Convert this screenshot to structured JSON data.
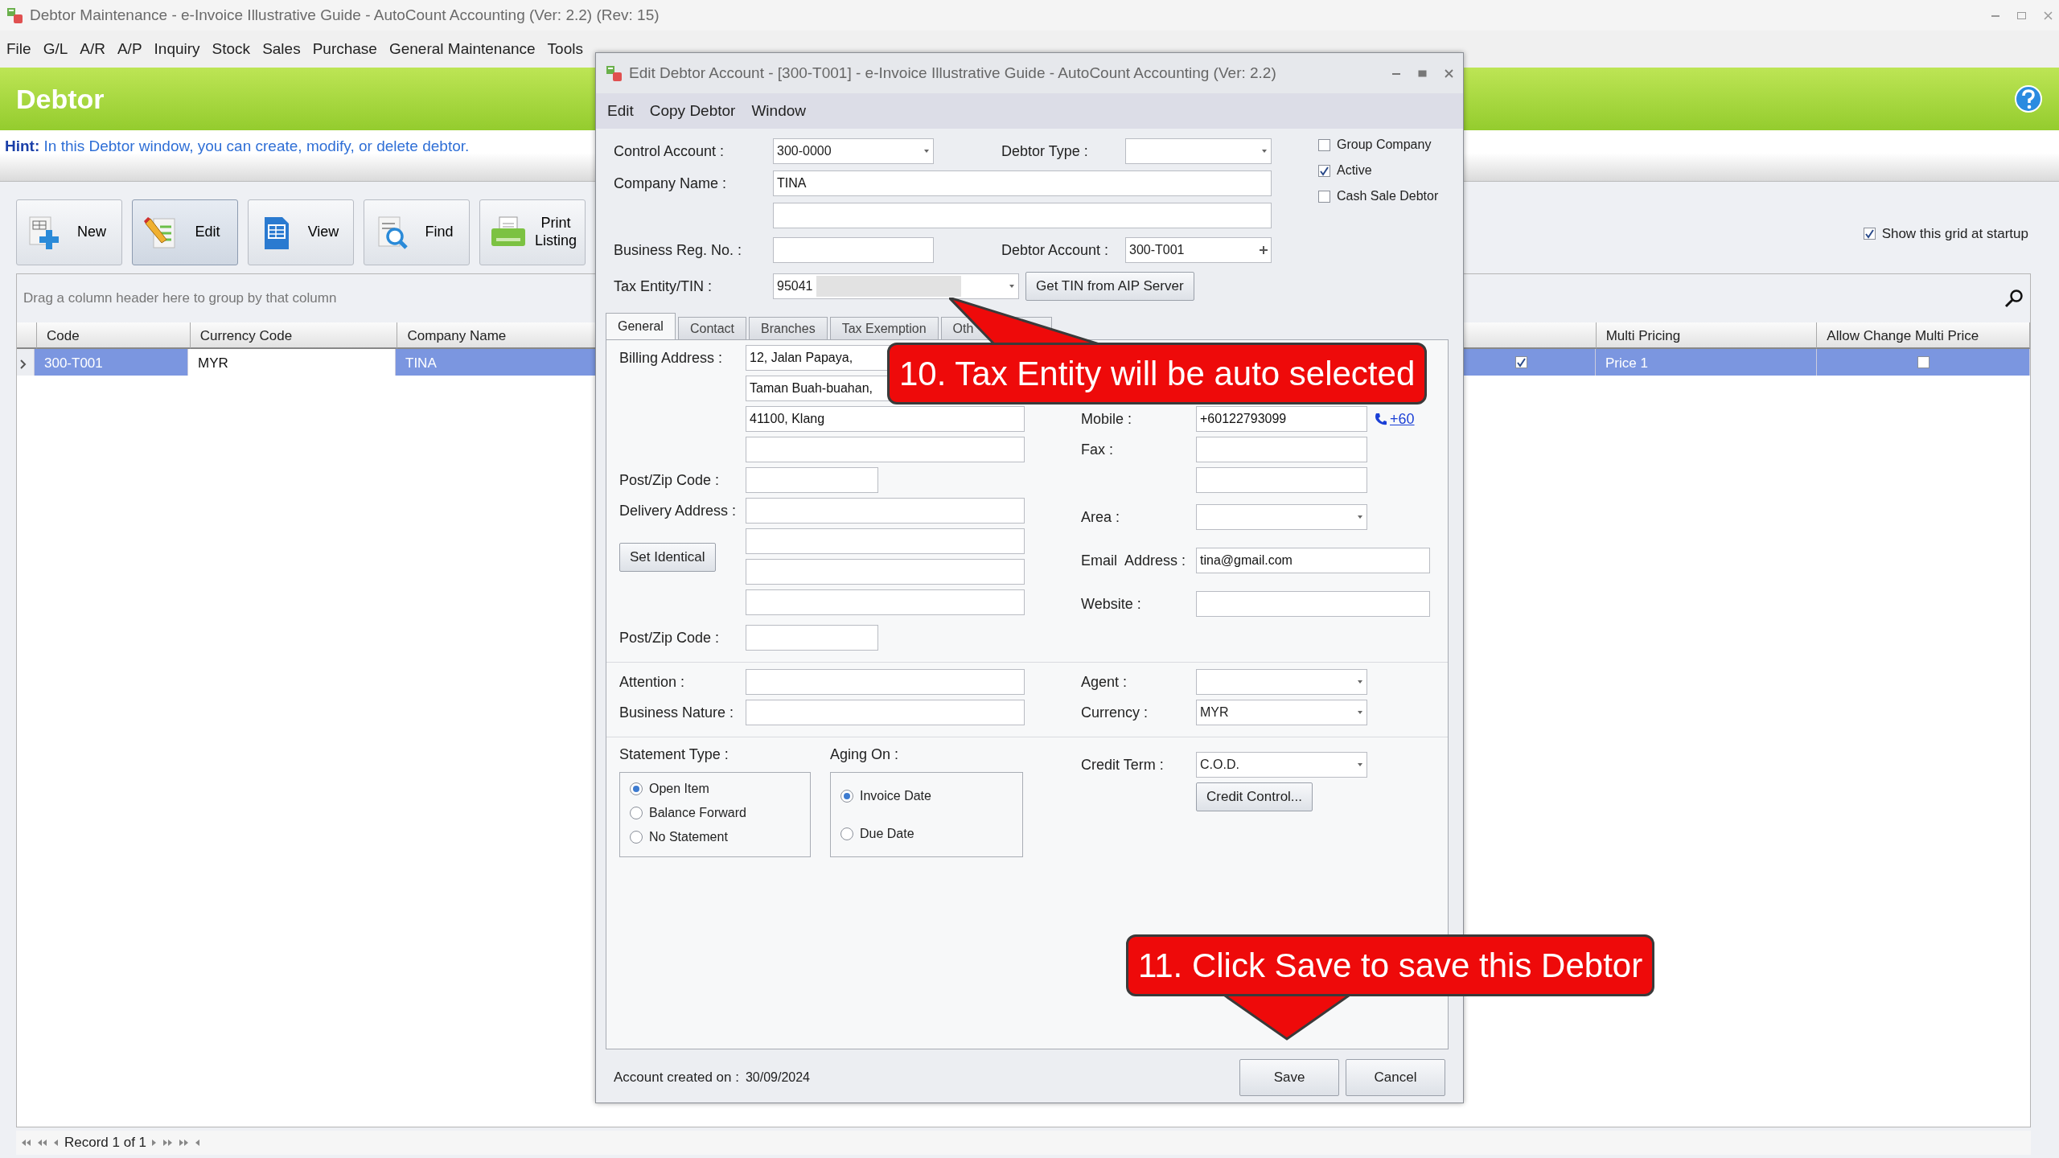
{
  "window": {
    "title": "Debtor Maintenance - e-Invoice Illustrative Guide - AutoCount Accounting (Ver: 2.2) (Rev: 15)"
  },
  "menu": [
    "File",
    "G/L",
    "A/R",
    "A/P",
    "Inquiry",
    "Stock",
    "Sales",
    "Purchase",
    "General Maintenance",
    "Tools"
  ],
  "header": {
    "title": "Debtor"
  },
  "hint": "**Hint:** In this Debtor window, you can create, modify, or delete debtor.",
  "toolbar": [
    {
      "label": "New",
      "selected": false
    },
    {
      "label": "Edit",
      "selected": true
    },
    {
      "label": "View",
      "selected": false
    },
    {
      "label": "Find",
      "selected": false
    },
    {
      "label": "Print Listing",
      "selected": false
    }
  ],
  "show_grid_at_startup": {
    "label": "Show this grid at startup",
    "checked": true
  },
  "grid": {
    "group_hint": "Drag a column header here to group by that column",
    "columns": [
      {
        "label": "Code"
      },
      {
        "label": "Currency Code"
      },
      {
        "label": "Company Name"
      },
      {},
      {
        "label": "Multi Pricing"
      },
      {
        "label": "Allow Change Multi Price"
      }
    ],
    "rows": [
      {
        "selected": true,
        "cells": [
          {
            "kind": "text",
            "text": "300-T001",
            "focused": false
          },
          {
            "kind": "text",
            "text": "MYR",
            "focused": true
          },
          {
            "kind": "text",
            "text": "TINA",
            "focused": false
          },
          {
            "kind": "check",
            "checked": true,
            "focused": false
          },
          {
            "kind": "text",
            "text": "Price 1",
            "focused": false
          },
          {
            "kind": "check",
            "checked": false,
            "focused": false
          }
        ]
      }
    ]
  },
  "navigator": {
    "text": "Record 1 of 1"
  },
  "dialog": {
    "title": "Edit Debtor Account - [300-T001] - e-Invoice Illustrative Guide - AutoCount Accounting (Ver: 2.2)",
    "menu": [
      "Edit",
      "Copy Debtor",
      "Window"
    ],
    "control_account": {
      "label": "Control Account :",
      "value": "300-0000"
    },
    "debtor_type": {
      "label": "Debtor Type :"
    },
    "company_name": {
      "label": "Company Name :",
      "value": "TINA"
    },
    "business_reg": {
      "label": "Business Reg. No. :"
    },
    "debtor_account": {
      "label": "Debtor Account :",
      "value": "300-T001"
    },
    "tax_entity": {
      "label": "Tax Entity/TIN :",
      "value": "95041"
    },
    "get_tin_button": "Get TIN from AIP Server",
    "flags": [
      {
        "label": "Group Company",
        "checked": false
      },
      {
        "label": "Active",
        "checked": true
      },
      {
        "label": "Cash Sale Debtor",
        "checked": false
      }
    ],
    "tabs": [
      {
        "label": "General",
        "selected": true
      },
      {
        "label": "Contact",
        "selected": false
      },
      {
        "label": "Branches",
        "selected": false
      },
      {
        "label": "Tax Exemption",
        "selected": false
      },
      {
        "label": "Oth",
        "selected": false
      }
    ],
    "billing": {
      "label": "Billing Address :",
      "lines": [
        "12, Jalan Papaya,",
        "Taman Buah-buahan,",
        "41100, Klang"
      ]
    },
    "billing_postcode": {
      "label": "Post/Zip Code :"
    },
    "delivery": {
      "label": "Delivery Address :"
    },
    "set_identical_button": "Set Identical",
    "delivery_postcode": {
      "label": "Post/Zip Code :"
    },
    "mobile": {
      "label": "Mobile :",
      "value": "+60122793099",
      "dial_link": "+60"
    },
    "fax": {
      "label": "Fax :"
    },
    "area": {
      "label": "Area :"
    },
    "email": {
      "label": "Email  Address :",
      "value": "tina@gmail.com"
    },
    "website": {
      "label": "Website :"
    },
    "attention": {
      "label": "Attention :"
    },
    "business_nature": {
      "label": "Business Nature :"
    },
    "agent": {
      "label": "Agent :"
    },
    "currency": {
      "label": "Currency :",
      "value": "MYR"
    },
    "statement_type": {
      "label": "Statement Type :",
      "options": [
        {
          "label": "Open Item",
          "selected": true
        },
        {
          "label": "Balance Forward",
          "selected": false
        },
        {
          "label": "No Statement",
          "selected": false
        }
      ]
    },
    "aging_on": {
      "label": "Aging On :",
      "options": [
        {
          "label": "Invoice Date",
          "selected": true
        },
        {
          "label": "Due Date",
          "selected": false
        }
      ]
    },
    "credit_term": {
      "label": "Credit Term :",
      "value": "C.O.D."
    },
    "credit_control_button": "Credit Control...",
    "created_label": "Account created on :",
    "created_date": "30/09/2024",
    "buttons": [
      "Save",
      "Cancel"
    ]
  },
  "callouts": [
    {
      "text": "10. Tax Entity will be auto selected"
    },
    {
      "text": "11. Click Save to save this Debtor"
    }
  ]
}
